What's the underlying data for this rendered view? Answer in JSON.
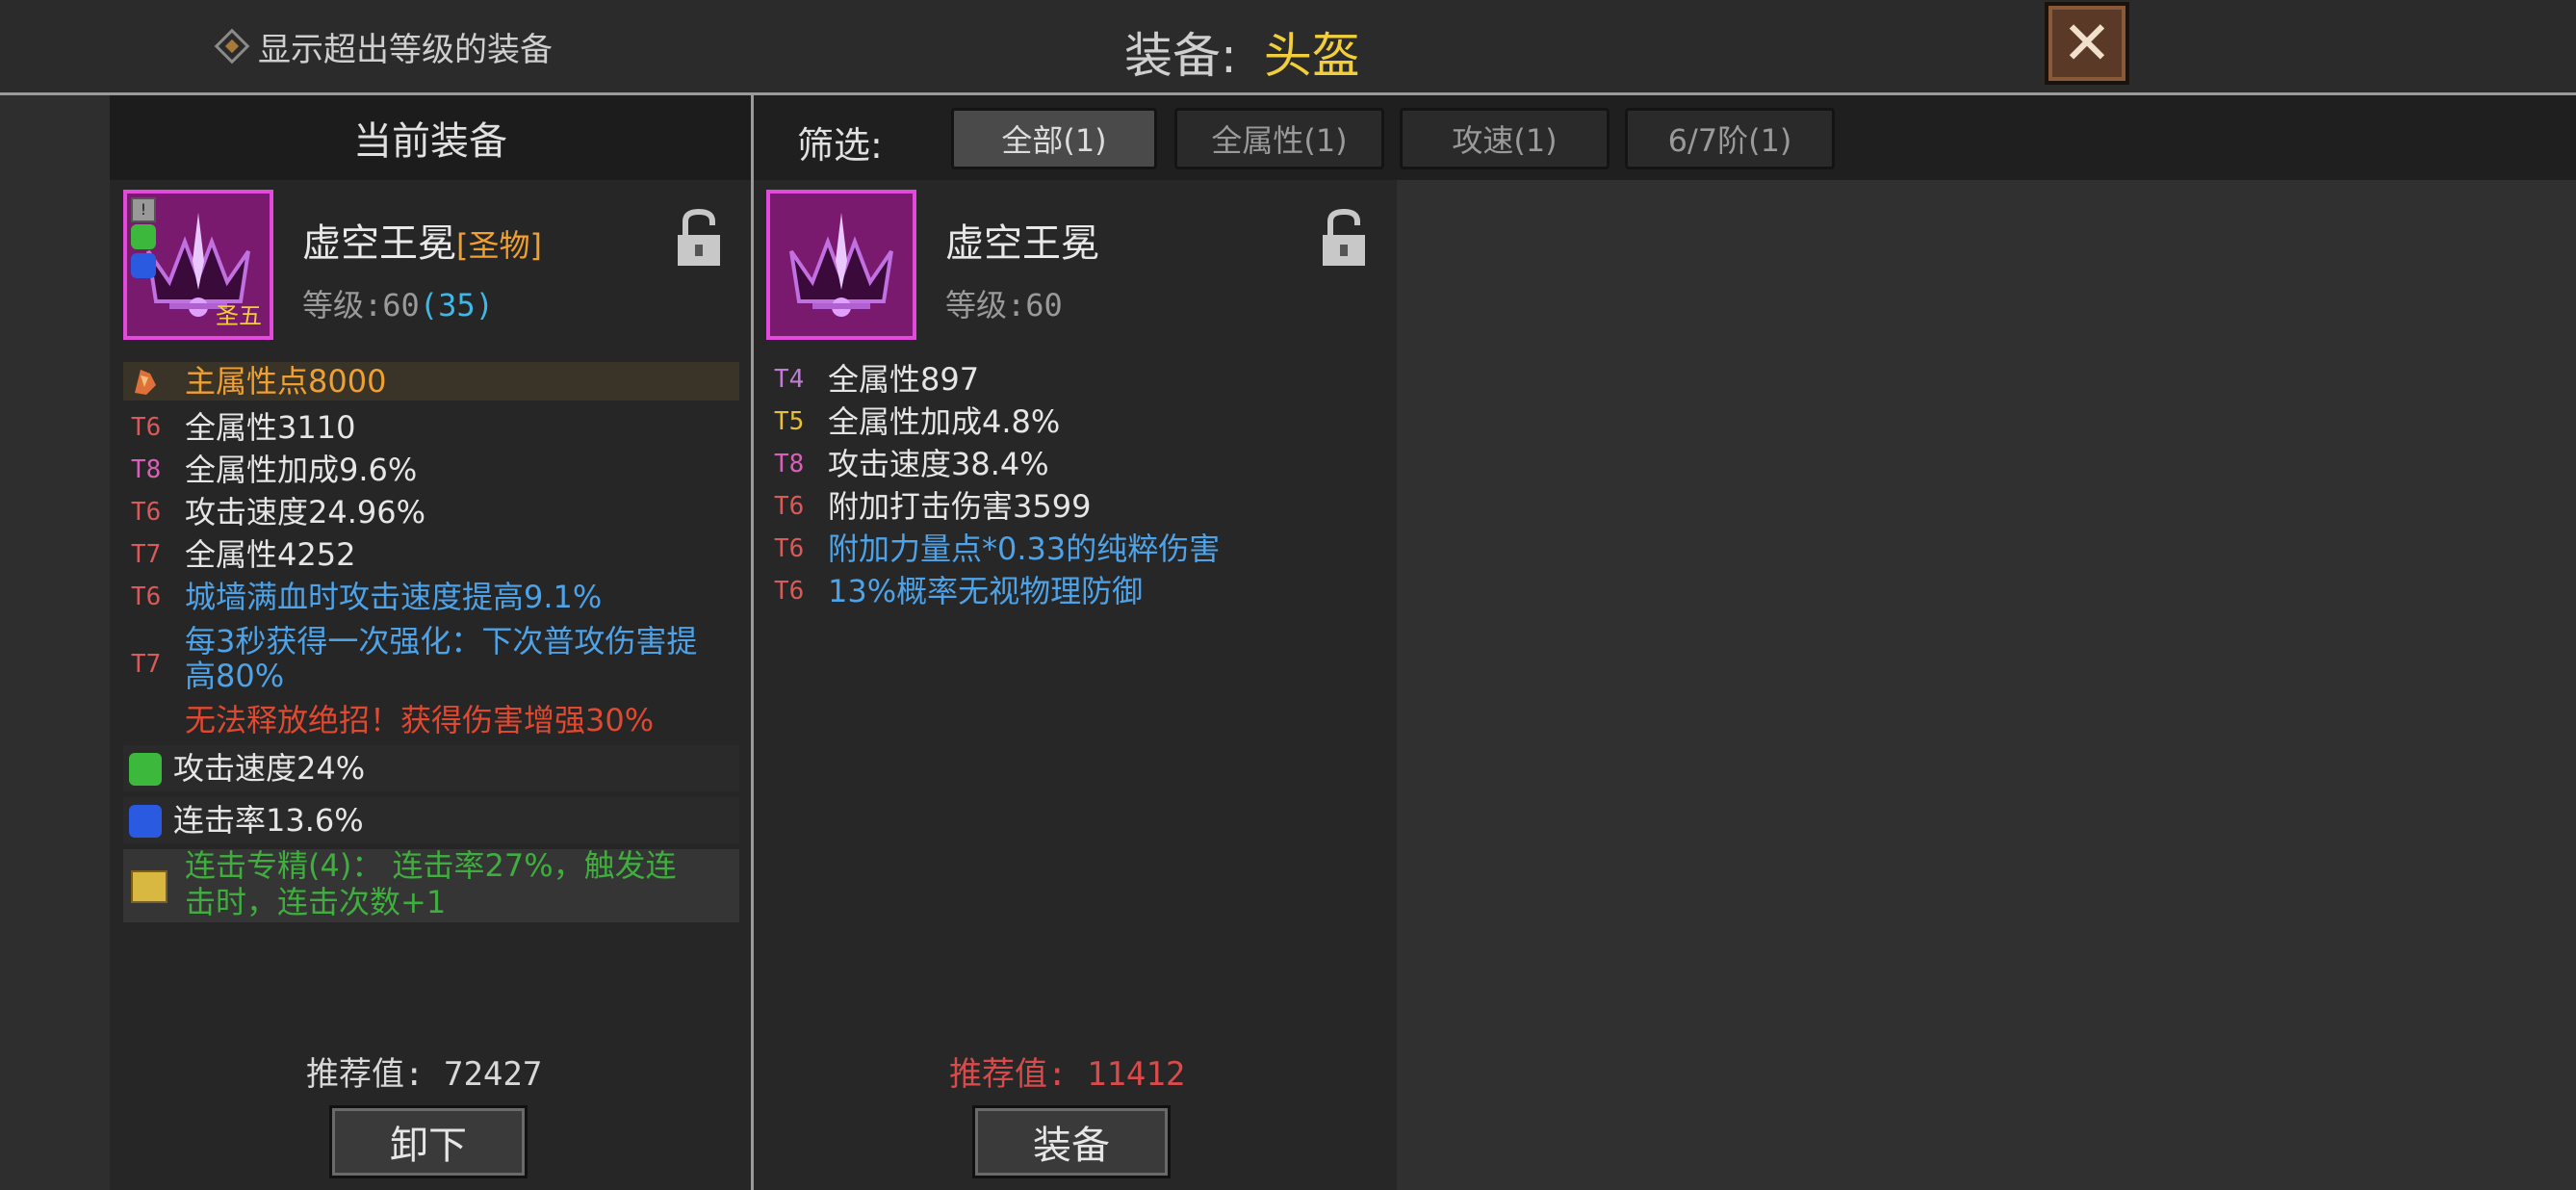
{
  "header": {
    "show_over_level_label": "显示超出等级的装备",
    "title_prefix": "装备:",
    "title_slot": "头盔",
    "close_icon": "close-x-icon"
  },
  "current": {
    "panel_title": "当前装备",
    "item_name": "虚空王冕",
    "item_tag": "[圣物]",
    "level_label": "等级:",
    "level": "60",
    "level_extra": "(35)",
    "badge_text": "圣五",
    "main_stat": "主属性点8000",
    "stats": [
      {
        "tier": "T6",
        "text": "全属性3110"
      },
      {
        "tier": "T8",
        "text": "全属性加成9.6%"
      },
      {
        "tier": "T6",
        "text": "攻击速度24.96%"
      },
      {
        "tier": "T7",
        "text": "全属性4252"
      },
      {
        "tier": "T6",
        "text": "城墙满血时攻击速度提高9.1%"
      },
      {
        "tier": "T7",
        "text": "每3秒获得一次强化：下次普攻伤害提",
        "text2": "高80%"
      }
    ],
    "drawback": "无法释放绝招！获得伤害增强30%",
    "gem1": "攻击速度24%",
    "gem2": "连击率13.6%",
    "set_bonus_1": "连击专精(4)： 连击率27%，触发连",
    "set_bonus_2": "击时，连击次数+1",
    "recommend_label": "推荐值:",
    "recommend_value": "72427",
    "unequip_label": "卸下"
  },
  "filter": {
    "label": "筛选:",
    "chips": [
      "全部(1)",
      "全属性(1)",
      "攻速(1)",
      "6/7阶(1)"
    ]
  },
  "candidate": {
    "item_name": "虚空王冕",
    "level_label": "等级:",
    "level": "60",
    "stats": [
      {
        "tier": "T4",
        "text": "全属性897"
      },
      {
        "tier": "T5",
        "text": "全属性加成4.8%"
      },
      {
        "tier": "T8",
        "text": "攻击速度38.4%"
      },
      {
        "tier": "T6",
        "text": "附加打击伤害3599"
      },
      {
        "tier": "T6",
        "text": "附加力量点*0.33的纯粹伤害"
      },
      {
        "tier": "T6",
        "text": "13%概率无视物理防御"
      }
    ],
    "recommend_label": "推荐值:",
    "recommend_value": "11412",
    "equip_label": "装备"
  },
  "colors": {
    "title_slot": "#f2cf3a",
    "item_tag": "#f0a030",
    "level_extra": "#3fb8e8",
    "recommend_better": "#d8d8d8",
    "recommend_worse": "#d94a4a",
    "icon_border": "#e24adb"
  }
}
